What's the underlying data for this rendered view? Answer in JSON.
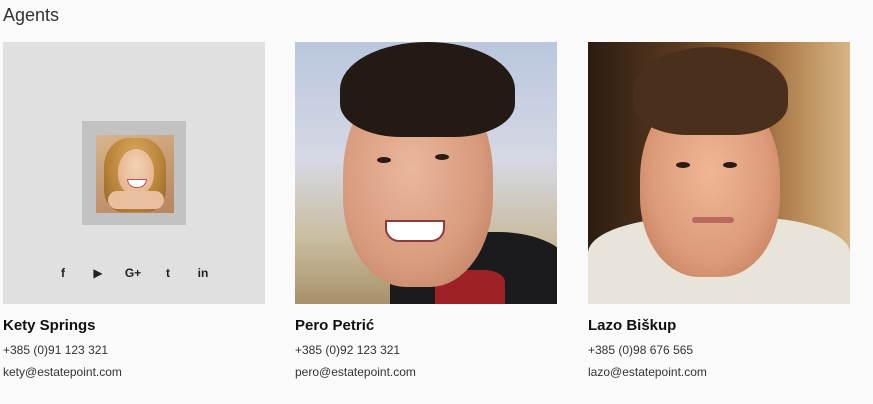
{
  "section": {
    "title": "Agents"
  },
  "agents": [
    {
      "name": "Kety Springs",
      "phone": "+385 (0)91 123 321",
      "email": "kety@estatepoint.com",
      "socials": [
        {
          "icon": "facebook-icon",
          "glyph": "f"
        },
        {
          "icon": "youtube-icon",
          "glyph": "▶"
        },
        {
          "icon": "google-plus-icon",
          "glyph": "G+"
        },
        {
          "icon": "twitter-icon",
          "glyph": "t"
        },
        {
          "icon": "linkedin-icon",
          "glyph": "in"
        }
      ]
    },
    {
      "name": "Pero Petrić",
      "phone": "+385 (0)92 123 321",
      "email": "pero@estatepoint.com"
    },
    {
      "name": "Lazo Biškup",
      "phone": "+385 (0)98 676 565",
      "email": "lazo@estatepoint.com"
    }
  ]
}
